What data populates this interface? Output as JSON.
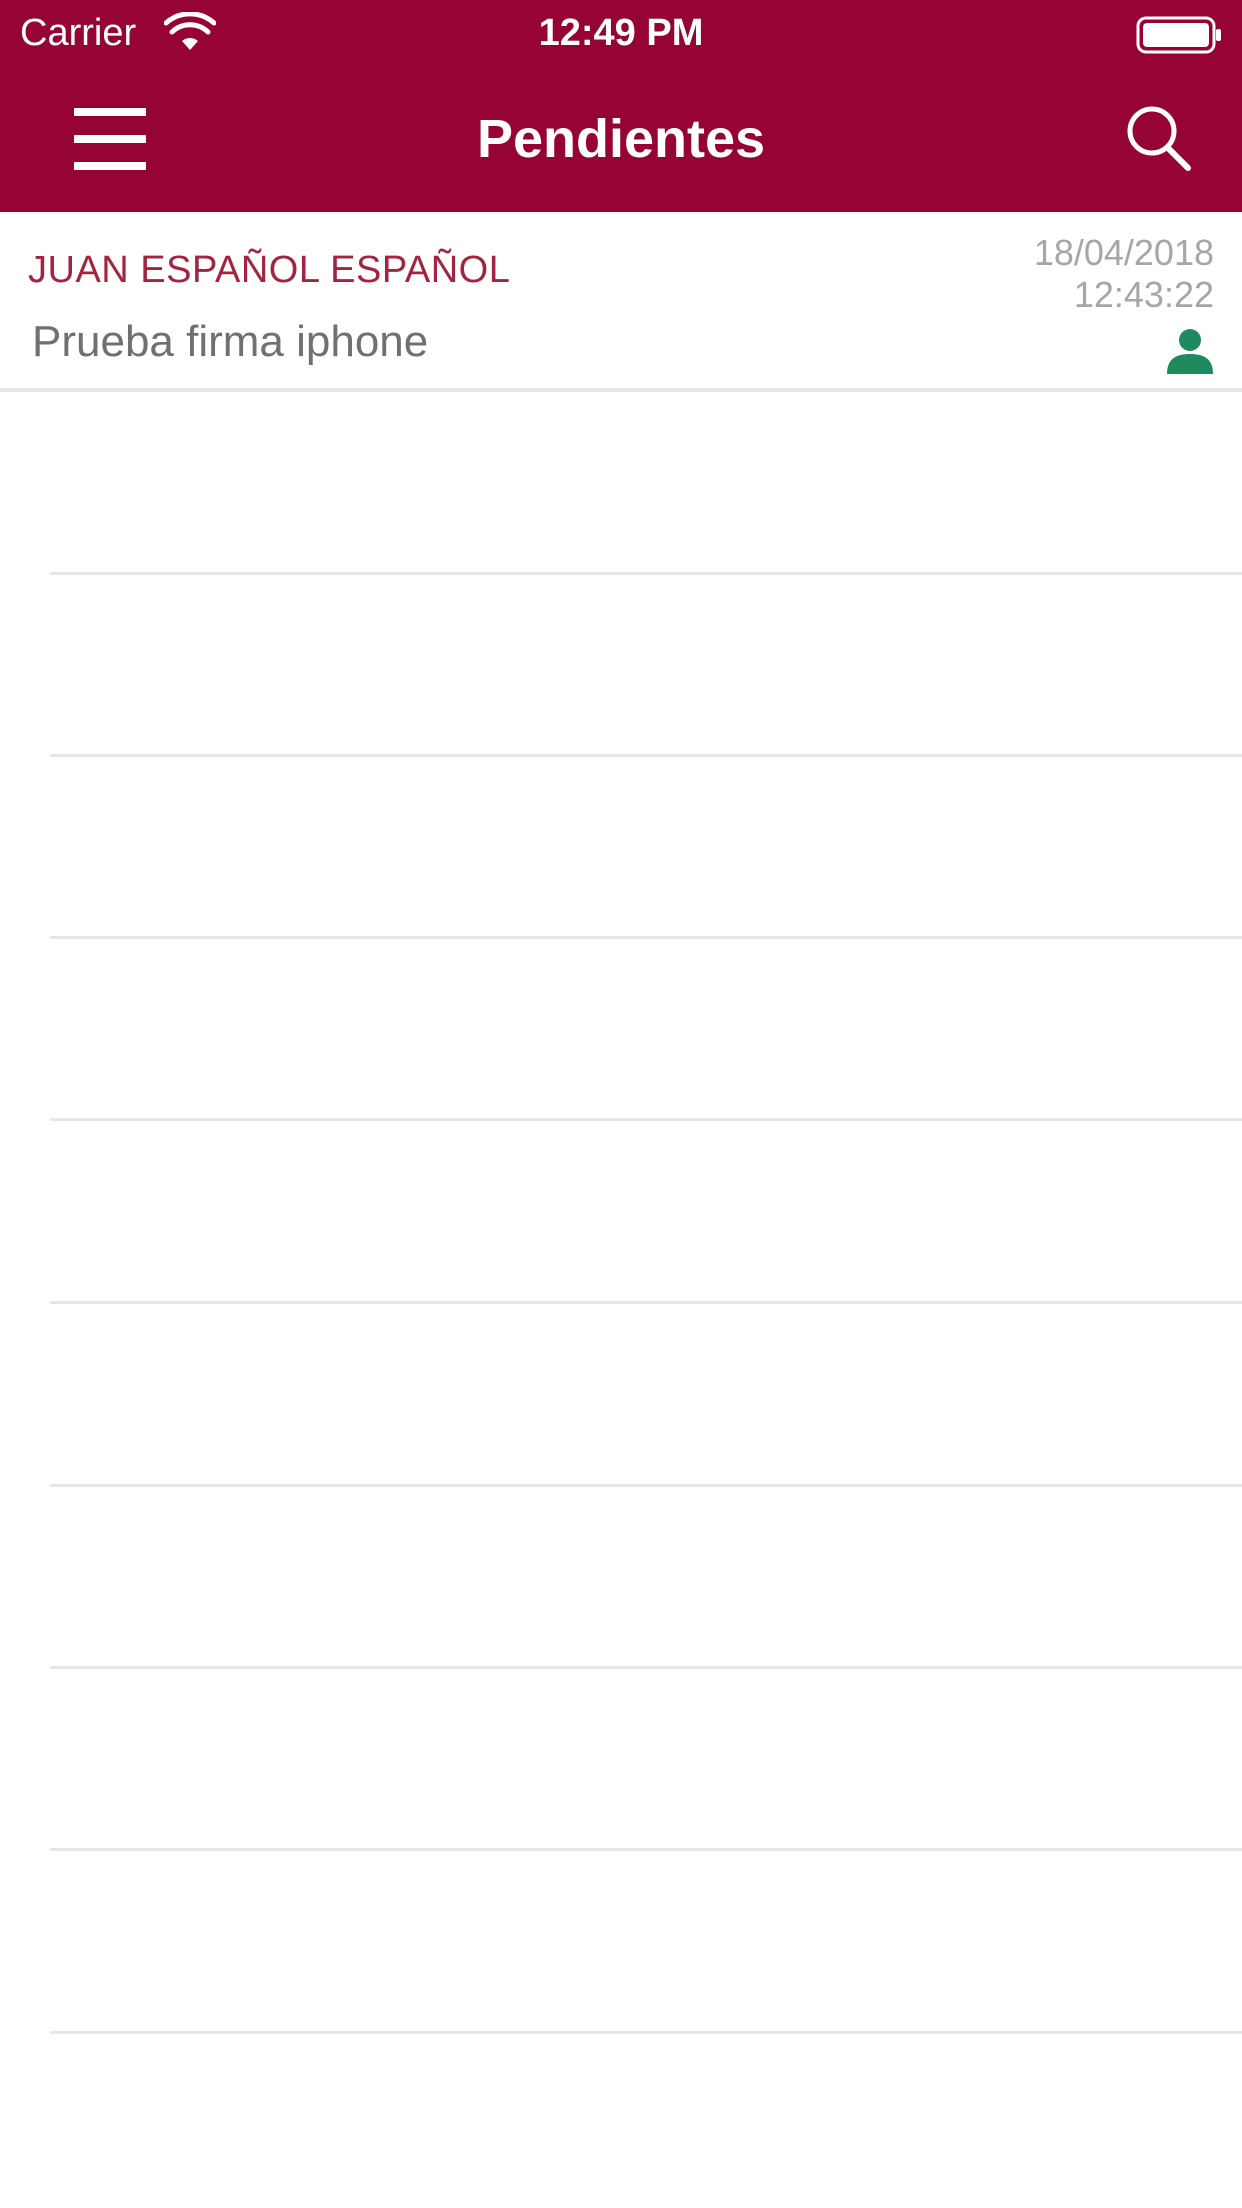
{
  "status_bar": {
    "carrier": "Carrier",
    "time": "12:49 PM",
    "wifi_icon": "wifi-icon",
    "battery_icon": "battery-full-icon"
  },
  "header": {
    "title": "Pendientes",
    "menu_icon": "hamburger-menu-icon",
    "search_icon": "search-icon",
    "background_color": "#960434"
  },
  "list": {
    "items": [
      {
        "sender": "JUAN ESPAÑOL ESPAÑOL",
        "subject": "Prueba firma iphone",
        "date": "18/04/2018",
        "time": "12:43:22",
        "status_icon": "user-icon",
        "status_color": "#1f8a5e"
      }
    ]
  },
  "colors": {
    "accent": "#960434",
    "sender_text": "#a3243f",
    "subject_text": "#707070",
    "date_text": "#a6a6a6",
    "separator": "#e6e6e6"
  }
}
